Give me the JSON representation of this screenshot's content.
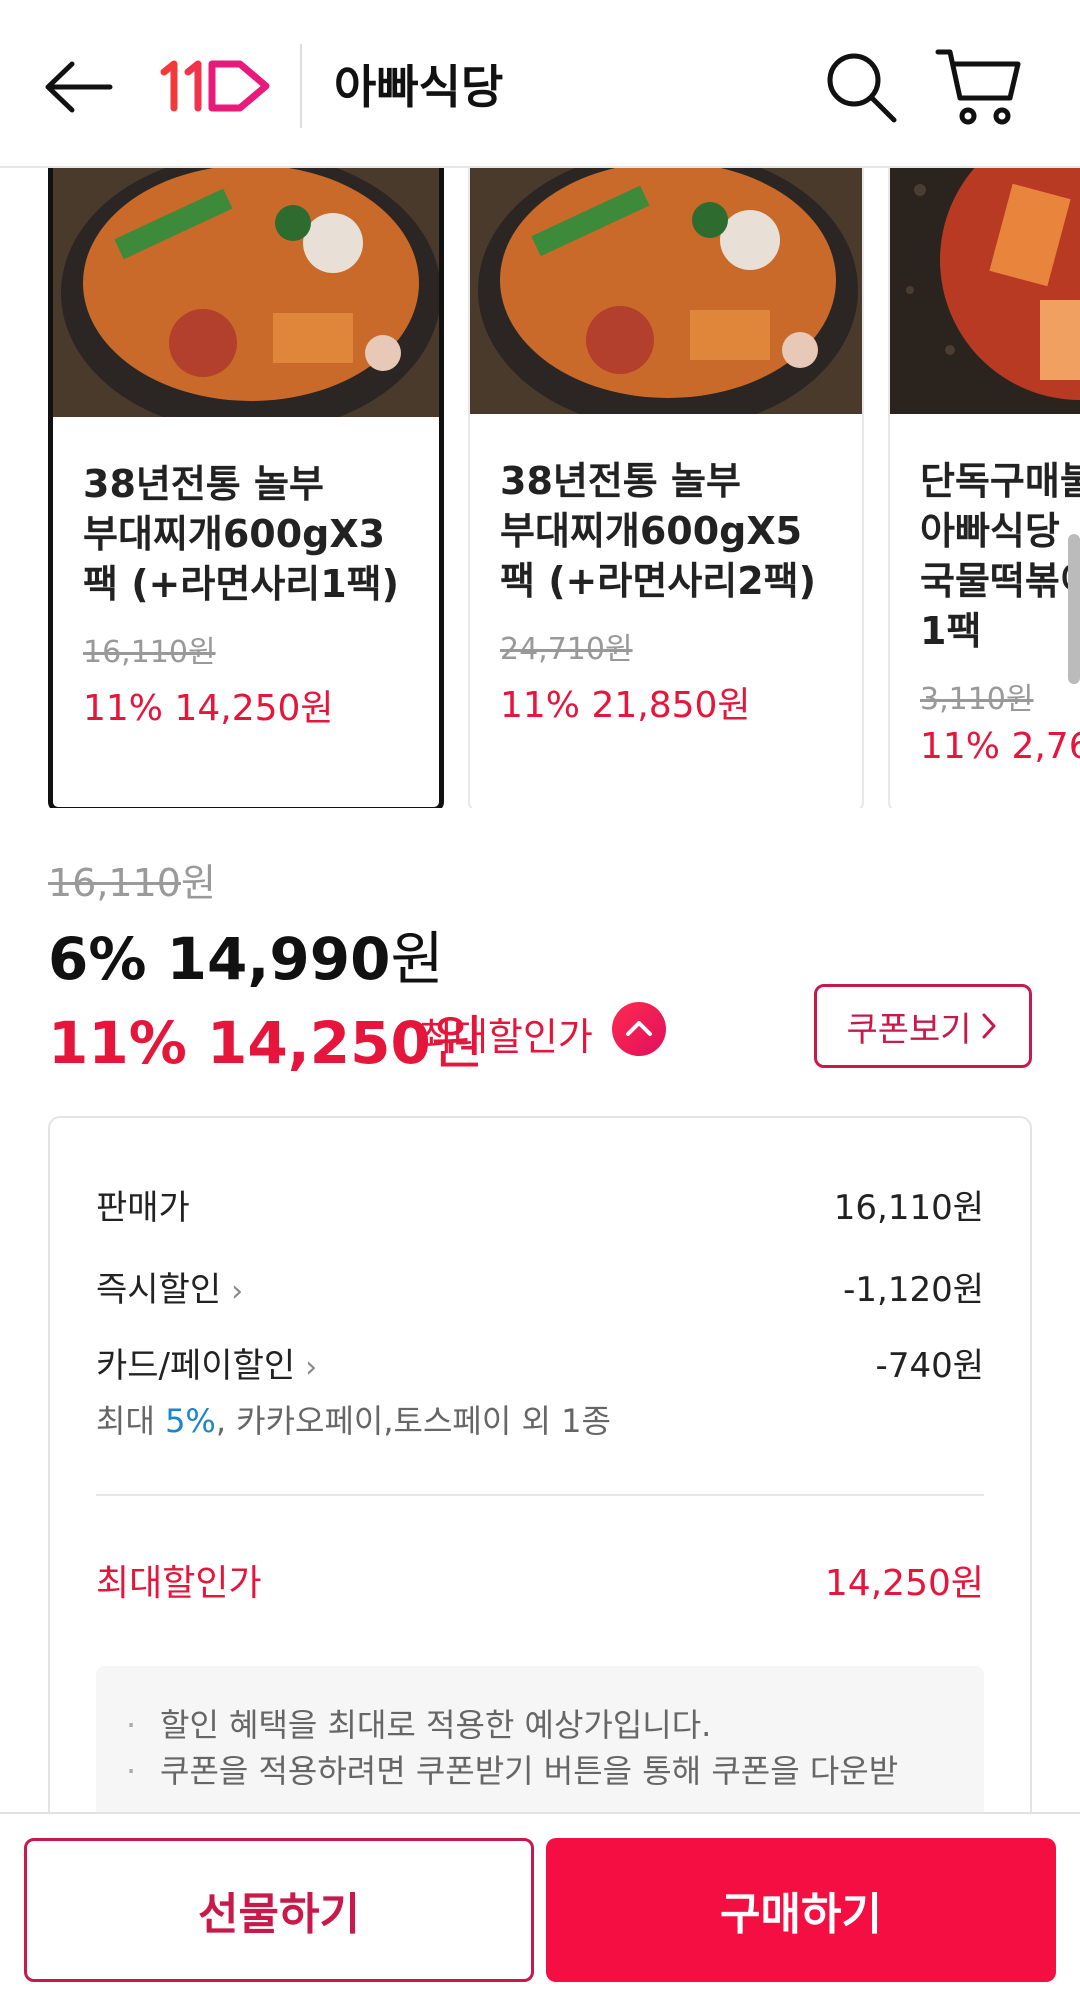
{
  "header": {
    "title": "아빠식당",
    "logo_text": "11"
  },
  "carousel": {
    "items": [
      {
        "name_lines": [
          "38년전통 놀부",
          "부대찌개600gX3",
          "팩 (+라면사리1팩)"
        ],
        "original_price": "16,110원",
        "discount_price": "11% 14,250원",
        "selected": true
      },
      {
        "name_lines": [
          "38년전통 놀부",
          "부대찌개600gX5",
          "팩 (+라면사리2팩)"
        ],
        "original_price": "24,710원",
        "discount_price": "11% 21,850원",
        "selected": false
      },
      {
        "name_lines": [
          "단독구매불",
          "아빠식당",
          "국물떡볶이",
          "1팩"
        ],
        "original_price": "3,110원",
        "discount_price": "11% 2,76",
        "selected": false
      }
    ]
  },
  "price": {
    "original_number": "16,110",
    "original_unit": "원",
    "current_rate_amount": "6% 14,990",
    "current_unit": "원",
    "max_rate_amount": "11% 14,250",
    "max_unit": "원",
    "max_label": "최대할인가",
    "coupon_button": "쿠폰보기"
  },
  "breakdown": {
    "sale_label": "판매가",
    "sale_value": "16,110원",
    "instant_label": "즉시할인",
    "instant_value": "-1,120원",
    "card_label": "카드/페이할인",
    "card_value": "-740원",
    "card_sub_prefix": "최대 ",
    "card_sub_pct": "5%",
    "card_sub_suffix": ", 카카오페이,토스페이 외 1종",
    "total_label": "최대할인가",
    "total_value": "14,250원",
    "notices": [
      "할인 혜택을 최대로 적용한 예상가입니다.",
      "쿠폰을 적용하려면 쿠폰받기 버튼을 통해 쿠폰을 다운받"
    ]
  },
  "bottom": {
    "gift_label": "선물하기",
    "buy_label": "구매하기"
  },
  "colors": {
    "brand_red": "#e5153b",
    "buy_button": "#f40e41",
    "outline_red": "#c81a4a",
    "link_blue": "#1a85c8"
  }
}
